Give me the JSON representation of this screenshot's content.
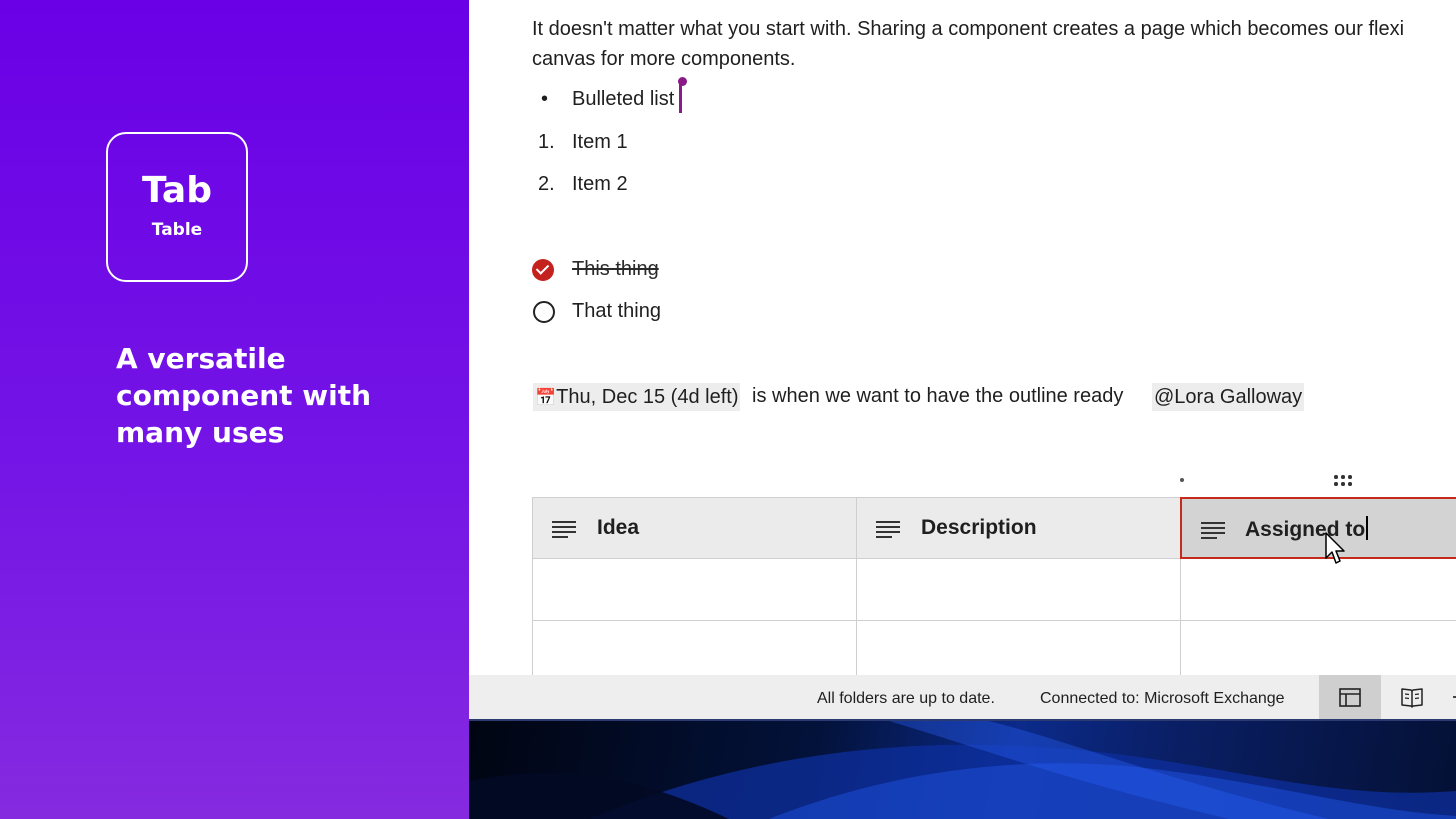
{
  "left_panel": {
    "tab_title": "Tab",
    "tab_subtitle": "Table",
    "headline": "A versatile component with many uses"
  },
  "document": {
    "intro_line1": "It doesn't matter what you start with. Sharing a component creates a page which becomes our flexi",
    "intro_line2": "canvas for more components.",
    "bullet_symbol": "•",
    "bullet_text": "Bulleted list",
    "numbered": [
      {
        "num": "1.",
        "text": "Item 1"
      },
      {
        "num": "2.",
        "text": "Item 2"
      }
    ],
    "tasks": [
      {
        "text": "This thing",
        "done": true
      },
      {
        "text": "That thing",
        "done": false
      }
    ],
    "date_icon": "calendar-icon",
    "date_chip": "Thu, Dec 15 (4d left)",
    "sentence": "is when we want to have the outline ready",
    "mention": "@Lora Galloway"
  },
  "table": {
    "columns": [
      {
        "label": "Idea",
        "icon": "text-lines-icon"
      },
      {
        "label": "Description",
        "icon": "text-lines-icon"
      },
      {
        "label": "Assigned to",
        "icon": "text-lines-icon",
        "editing": true
      }
    ]
  },
  "status_bar": {
    "sync_status": "All folders are up to date.",
    "connection": "Connected to: Microsoft Exchange",
    "view_buttons": [
      "normal-view-icon",
      "reading-view-icon"
    ]
  },
  "colors": {
    "panel_purple": "#6a00e6",
    "task_done_red": "#c4221f",
    "active_header_border": "#c42b1c",
    "cursor_purple": "#8a1a86"
  }
}
